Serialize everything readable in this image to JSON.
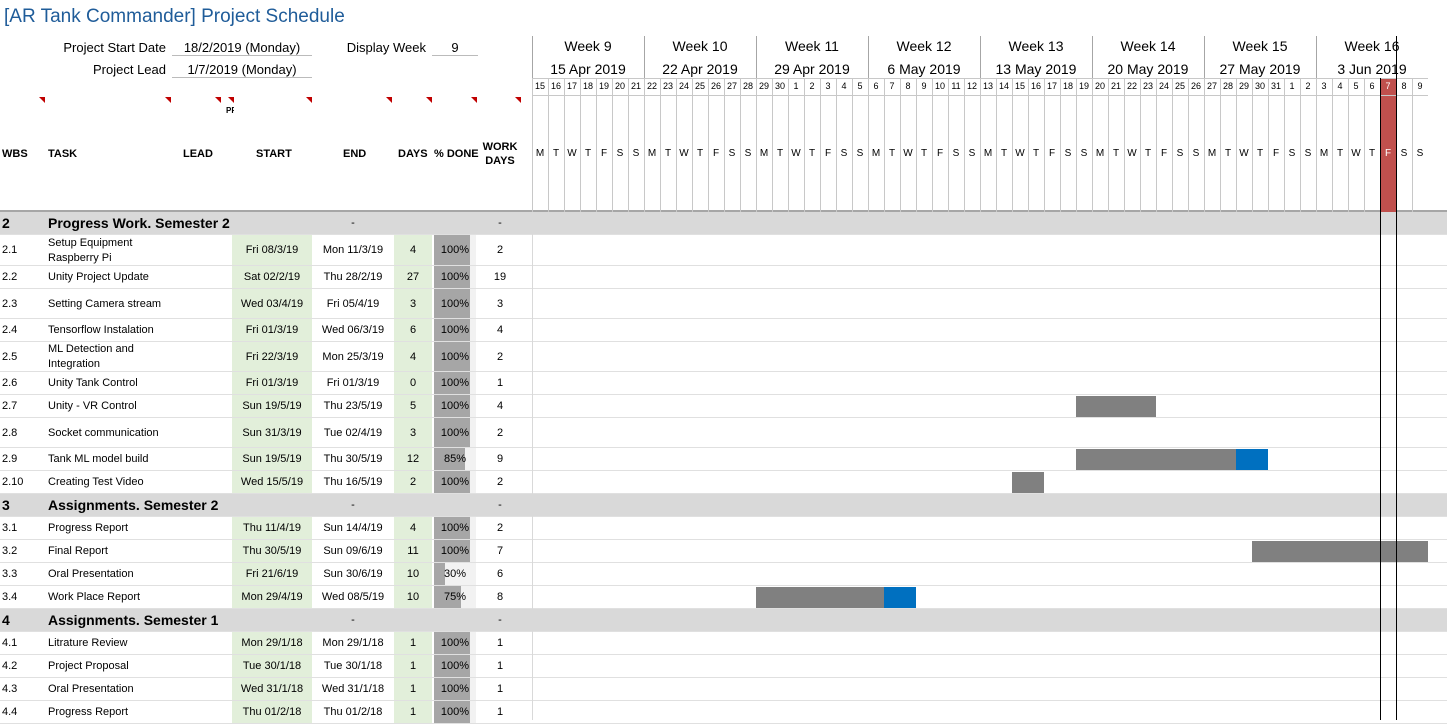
{
  "title": "[AR Tank Commander] Project Schedule",
  "header": {
    "project_start_label": "Project Start Date",
    "project_start_value": "18/2/2019 (Monday)",
    "project_lead_label": "Project Lead",
    "project_lead_value": "1/7/2019 (Monday)",
    "display_week_label": "Display Week",
    "display_week_value": "9"
  },
  "columns": {
    "wbs": "WBS",
    "task": "TASK",
    "lead": "LEAD",
    "predecessor": "PREDECESSOR",
    "start": "START",
    "end": "END",
    "days": "DAYS",
    "done": "% DONE",
    "work_days": "WORK\nDAYS"
  },
  "weeks": [
    {
      "label": "Week 9",
      "date": "15 Apr 2019"
    },
    {
      "label": "Week 10",
      "date": "22 Apr 2019"
    },
    {
      "label": "Week 11",
      "date": "29 Apr 2019"
    },
    {
      "label": "Week 12",
      "date": "6 May 2019"
    },
    {
      "label": "Week 13",
      "date": "13 May 2019"
    },
    {
      "label": "Week 14",
      "date": "20 May 2019"
    },
    {
      "label": "Week 15",
      "date": "27 May 2019"
    },
    {
      "label": "Week 16",
      "date": "3 Jun 2019"
    }
  ],
  "day_numbers": [
    "15",
    "16",
    "17",
    "18",
    "19",
    "20",
    "21",
    "22",
    "23",
    "24",
    "25",
    "26",
    "27",
    "28",
    "29",
    "30",
    "1",
    "2",
    "3",
    "4",
    "5",
    "6",
    "7",
    "8",
    "9",
    "10",
    "11",
    "12",
    "13",
    "14",
    "15",
    "16",
    "17",
    "18",
    "19",
    "20",
    "21",
    "22",
    "23",
    "24",
    "25",
    "26",
    "27",
    "28",
    "29",
    "30",
    "31",
    "1",
    "2",
    "3",
    "4",
    "5",
    "6",
    "7",
    "8",
    "9"
  ],
  "day_letters": [
    "M",
    "T",
    "W",
    "T",
    "F",
    "S",
    "S"
  ],
  "today_index": 53,
  "rows": [
    {
      "type": "section",
      "wbs": "2",
      "task": "Progress Work. Semester 2",
      "end": "-",
      "work": "-"
    },
    {
      "type": "task",
      "wbs": "2.1",
      "task": "Setup Equipment\nRaspberry Pi",
      "start": "Fri 08/3/19",
      "end": "Mon 11/3/19",
      "days": "4",
      "done": "100%",
      "done_value": 100,
      "work": "2"
    },
    {
      "type": "task",
      "wbs": "2.2",
      "task": "Unity Project Update",
      "start": "Sat 02/2/19",
      "end": "Thu 28/2/19",
      "days": "27",
      "done": "100%",
      "done_value": 100,
      "work": "19"
    },
    {
      "type": "task",
      "wbs": "2.3",
      "task": "Setting Camera stream",
      "start": "Wed 03/4/19",
      "end": "Fri 05/4/19",
      "days": "3",
      "done": "100%",
      "done_value": 100,
      "work": "3"
    },
    {
      "type": "task",
      "wbs": "2.4",
      "task": "Tensorflow Instalation",
      "start": "Fri 01/3/19",
      "end": "Wed 06/3/19",
      "days": "6",
      "done": "100%",
      "done_value": 100,
      "work": "4"
    },
    {
      "type": "task",
      "wbs": "2.5",
      "task": "ML Detection and\nIntegration",
      "start": "Fri 22/3/19",
      "end": "Mon 25/3/19",
      "days": "4",
      "done": "100%",
      "done_value": 100,
      "work": "2"
    },
    {
      "type": "task",
      "wbs": "2.6",
      "task": "Unity Tank Control",
      "start": "Fri 01/3/19",
      "end": "Fri 01/3/19",
      "days": "0",
      "done": "100%",
      "done_value": 100,
      "work": "1"
    },
    {
      "type": "task",
      "wbs": "2.7",
      "task": "Unity - VR Control",
      "start": "Sun 19/5/19",
      "end": "Thu 23/5/19",
      "days": "5",
      "done": "100%",
      "done_value": 100,
      "work": "4",
      "bar_start": 34,
      "bar_days": 5
    },
    {
      "type": "task",
      "wbs": "2.8",
      "task": "Socket communication",
      "start": "Sun 31/3/19",
      "end": "Tue 02/4/19",
      "days": "3",
      "done": "100%",
      "done_value": 100,
      "work": "2"
    },
    {
      "type": "task",
      "wbs": "2.9",
      "task": "Tank ML model build",
      "start": "Sun 19/5/19",
      "end": "Thu 30/5/19",
      "days": "12",
      "done": "85%",
      "done_value": 85,
      "work": "9",
      "bar_start": 34,
      "bar_days": 12
    },
    {
      "type": "task",
      "wbs": "2.10",
      "task": "Creating Test Video",
      "start": "Wed 15/5/19",
      "end": "Thu 16/5/19",
      "days": "2",
      "done": "100%",
      "done_value": 100,
      "work": "2",
      "bar_start": 30,
      "bar_days": 2
    },
    {
      "type": "section",
      "wbs": "3",
      "task": "Assignments. Semester 2",
      "end": "-",
      "work": "-"
    },
    {
      "type": "task",
      "wbs": "3.1",
      "task": "Progress Report",
      "start": "Thu 11/4/19",
      "end": "Sun 14/4/19",
      "days": "4",
      "done": "100%",
      "done_value": 100,
      "work": "2"
    },
    {
      "type": "task",
      "wbs": "3.2",
      "task": "Final Report",
      "start": "Thu 30/5/19",
      "end": "Sun 09/6/19",
      "days": "11",
      "done": "100%",
      "done_value": 100,
      "work": "7",
      "bar_start": 45,
      "bar_days": 11
    },
    {
      "type": "task",
      "wbs": "3.3",
      "task": "Oral Presentation",
      "start": "Fri 21/6/19",
      "end": "Sun 30/6/19",
      "days": "10",
      "done": "30%",
      "done_value": 30,
      "work": "6"
    },
    {
      "type": "task",
      "wbs": "3.4",
      "task": "Work Place Report",
      "start": "Mon 29/4/19",
      "end": "Wed 08/5/19",
      "days": "10",
      "done": "75%",
      "done_value": 75,
      "work": "8",
      "bar_start": 14,
      "bar_days": 10
    },
    {
      "type": "section",
      "wbs": "4",
      "task": "Assignments. Semester 1",
      "end": "-",
      "work": "-"
    },
    {
      "type": "task",
      "wbs": "4.1",
      "task": "Litrature Review",
      "start": "Mon 29/1/18",
      "end": "Mon 29/1/18",
      "days": "1",
      "done": "100%",
      "done_value": 100,
      "work": "1"
    },
    {
      "type": "task",
      "wbs": "4.2",
      "task": "Project Proposal",
      "start": "Tue 30/1/18",
      "end": "Tue 30/1/18",
      "days": "1",
      "done": "100%",
      "done_value": 100,
      "work": "1"
    },
    {
      "type": "task",
      "wbs": "4.3",
      "task": "Oral Presentation",
      "start": "Wed 31/1/18",
      "end": "Wed 31/1/18",
      "days": "1",
      "done": "100%",
      "done_value": 100,
      "work": "1"
    },
    {
      "type": "task",
      "wbs": "4.4",
      "task": "Progress Report",
      "start": "Thu 01/2/18",
      "end": "Thu 01/2/18",
      "days": "1",
      "done": "100%",
      "done_value": 100,
      "work": "1"
    }
  ],
  "colors": {
    "title": "#1f5c99",
    "today": "#c0504d",
    "bar_done": "#808080",
    "bar_remaining": "#0070c0",
    "section": "#d9d9d9",
    "start_fill": "#e2efda",
    "pct_fill": "#a6a6a6"
  }
}
